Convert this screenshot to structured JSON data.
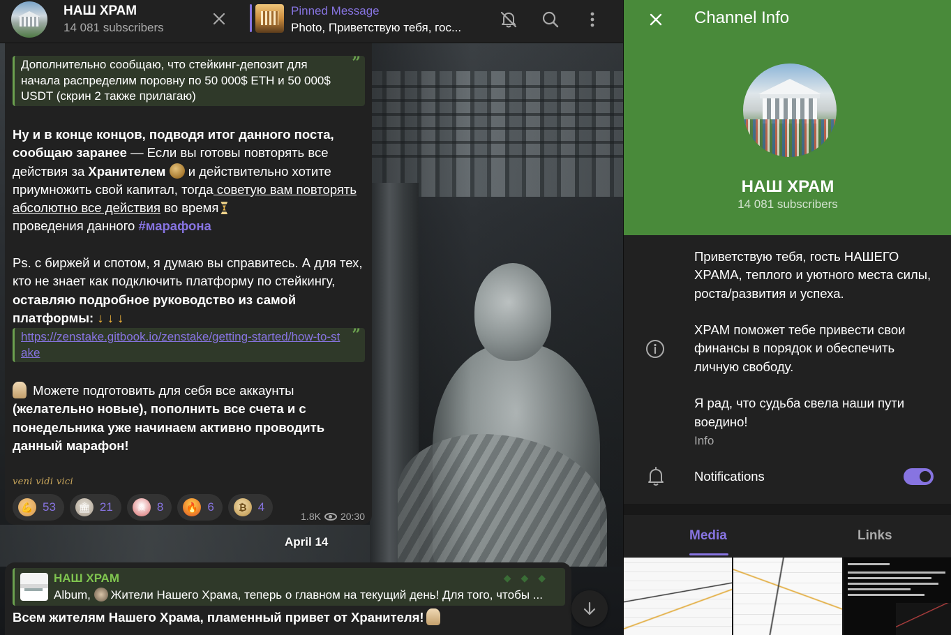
{
  "chat_header": {
    "title": "НАШ ХРАМ",
    "subscribers": "14 081 subscribers",
    "pinned_label": "Pinned Message",
    "pinned_text": "Photo, Приветствую тебя, гос..."
  },
  "message": {
    "quote1": "Дополнительно сообщаю, что стейкинг-депозит для начала распределим поровну по 50 000$ ETH и 50 000$ USDT (скрин 2 также прилагаю)",
    "p1_a": "Ну и в конце концов, подводя итог данного поста, сообщаю заранее",
    "p1_b": " — Если вы готовы повторять все действия за ",
    "p1_c": "Хранителем",
    "p1_d": " и действительно хотите приумножить свой капитал, тогда",
    "p1_e": " советую вам повторять абсолютно все действия",
    "p1_f": " во время",
    "p1_g": "проведения данного ",
    "p1_hashtag": "#марафона",
    "p2_a": "Ps. с биржей и спотом, я думаю вы справитесь. А для тех, кто не знает как подключить платформу по стейкингу, ",
    "p2_b": "оставляю подробное руководство из самой платформы:",
    "p2_arrows": "↓ ↓ ↓",
    "url": "https://zenstake.gitbook.io/zenstake/getting-started/how-to-stake",
    "p3_a": " Можете подготовить для себя все аккаунты ",
    "p3_b": "(желательно новые)",
    "p3_c": ", пополнить все счета и с понедельника уже начинаем активно проводить данный марафон!",
    "signature": "veni vidi vici",
    "reactions": [
      {
        "emoji": "flexed-biceps",
        "count": "53"
      },
      {
        "emoji": "classical-building",
        "count": "21"
      },
      {
        "emoji": "skull",
        "count": "8"
      },
      {
        "emoji": "torch",
        "count": "6"
      },
      {
        "emoji": "bitcoin",
        "count": "4"
      }
    ],
    "views": "1.8K",
    "time": "20:30"
  },
  "date_separator": "April 14",
  "message2": {
    "reply_name": "НАШ ХРАМ",
    "reply_text_a": "Album, ",
    "reply_text_b": "Жители Нашего Храма, теперь о главном на текущий день! Для того, чтобы ...",
    "text": "Всем жителям Нашего Храма, пламенный привет от Хранителя!"
  },
  "info_panel": {
    "title": "Channel Info",
    "name": "НАШ ХРАМ",
    "subscribers": "14 081 subscribers",
    "about": [
      "Приветствую тебя, гость НАШЕГО ХРАМА, теплого и уютного места силы, роста/развития и успеха.",
      "ХРАМ поможет тебе привести свои финансы в порядок и обеспечить личную свободу.",
      "Я рад, что судьба свела наши пути воедино!"
    ],
    "about_label": "Info",
    "notifications_label": "Notifications",
    "notifications_on": true,
    "tabs": [
      "Media",
      "Links"
    ]
  },
  "colors": {
    "accent": "#8774e1",
    "header_green": "#498a3a",
    "quote_green": "#6ba14f",
    "panel_bg": "#212121"
  }
}
